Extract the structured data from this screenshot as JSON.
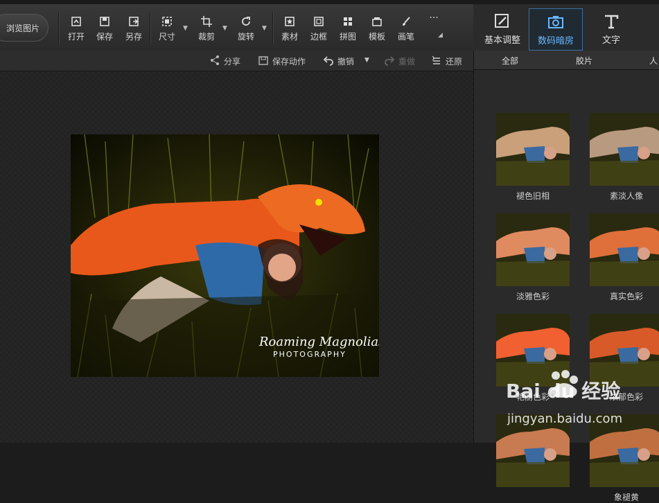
{
  "toolbar": {
    "browse_label": "浏览图片",
    "tools": [
      {
        "label": "打开",
        "icon": "open-icon"
      },
      {
        "label": "保存",
        "icon": "save-icon"
      },
      {
        "label": "另存",
        "icon": "save-as-icon"
      },
      {
        "label": "尺寸",
        "icon": "resize-icon"
      },
      {
        "label": "裁剪",
        "icon": "crop-icon"
      },
      {
        "label": "旋转",
        "icon": "rotate-icon"
      },
      {
        "label": "素材",
        "icon": "material-icon"
      },
      {
        "label": "边框",
        "icon": "border-icon"
      },
      {
        "label": "拼图",
        "icon": "collage-icon"
      },
      {
        "label": "模板",
        "icon": "template-icon"
      },
      {
        "label": "画笔",
        "icon": "brush-icon"
      }
    ],
    "more_label": "···"
  },
  "right_tabs": [
    {
      "label": "基本调整",
      "icon": "adjust-icon"
    },
    {
      "label": "数码暗房",
      "icon": "camera-icon"
    },
    {
      "label": "文字",
      "icon": "text-icon"
    }
  ],
  "subbar": {
    "share": "分享",
    "save_action": "保存动作",
    "undo": "撤销",
    "redo": "重做",
    "restore": "还原"
  },
  "categories": [
    "全部",
    "胶片",
    "人"
  ],
  "filters": [
    {
      "label": "褪色旧相",
      "tint": "#c9a07a"
    },
    {
      "label": "素淡人像",
      "tint": "#b89a80"
    },
    {
      "label": "淡雅色彩",
      "tint": "#e08a60"
    },
    {
      "label": "真实色彩",
      "tint": "#e0703a"
    },
    {
      "label": "艳丽色彩",
      "tint": "#f06030"
    },
    {
      "label": "浓郁色彩",
      "tint": "#d85a28"
    },
    {
      "label": "",
      "tint": "#c87a50"
    },
    {
      "label": "象褪黄",
      "tint": "#c07040"
    }
  ],
  "photo": {
    "watermark_line1": "Roaming Magnolias",
    "watermark_line2": "PHOTOGRAPHY"
  },
  "site_watermark": {
    "brand": "Bai du 经验",
    "url": "jingyan.baidu.com"
  }
}
